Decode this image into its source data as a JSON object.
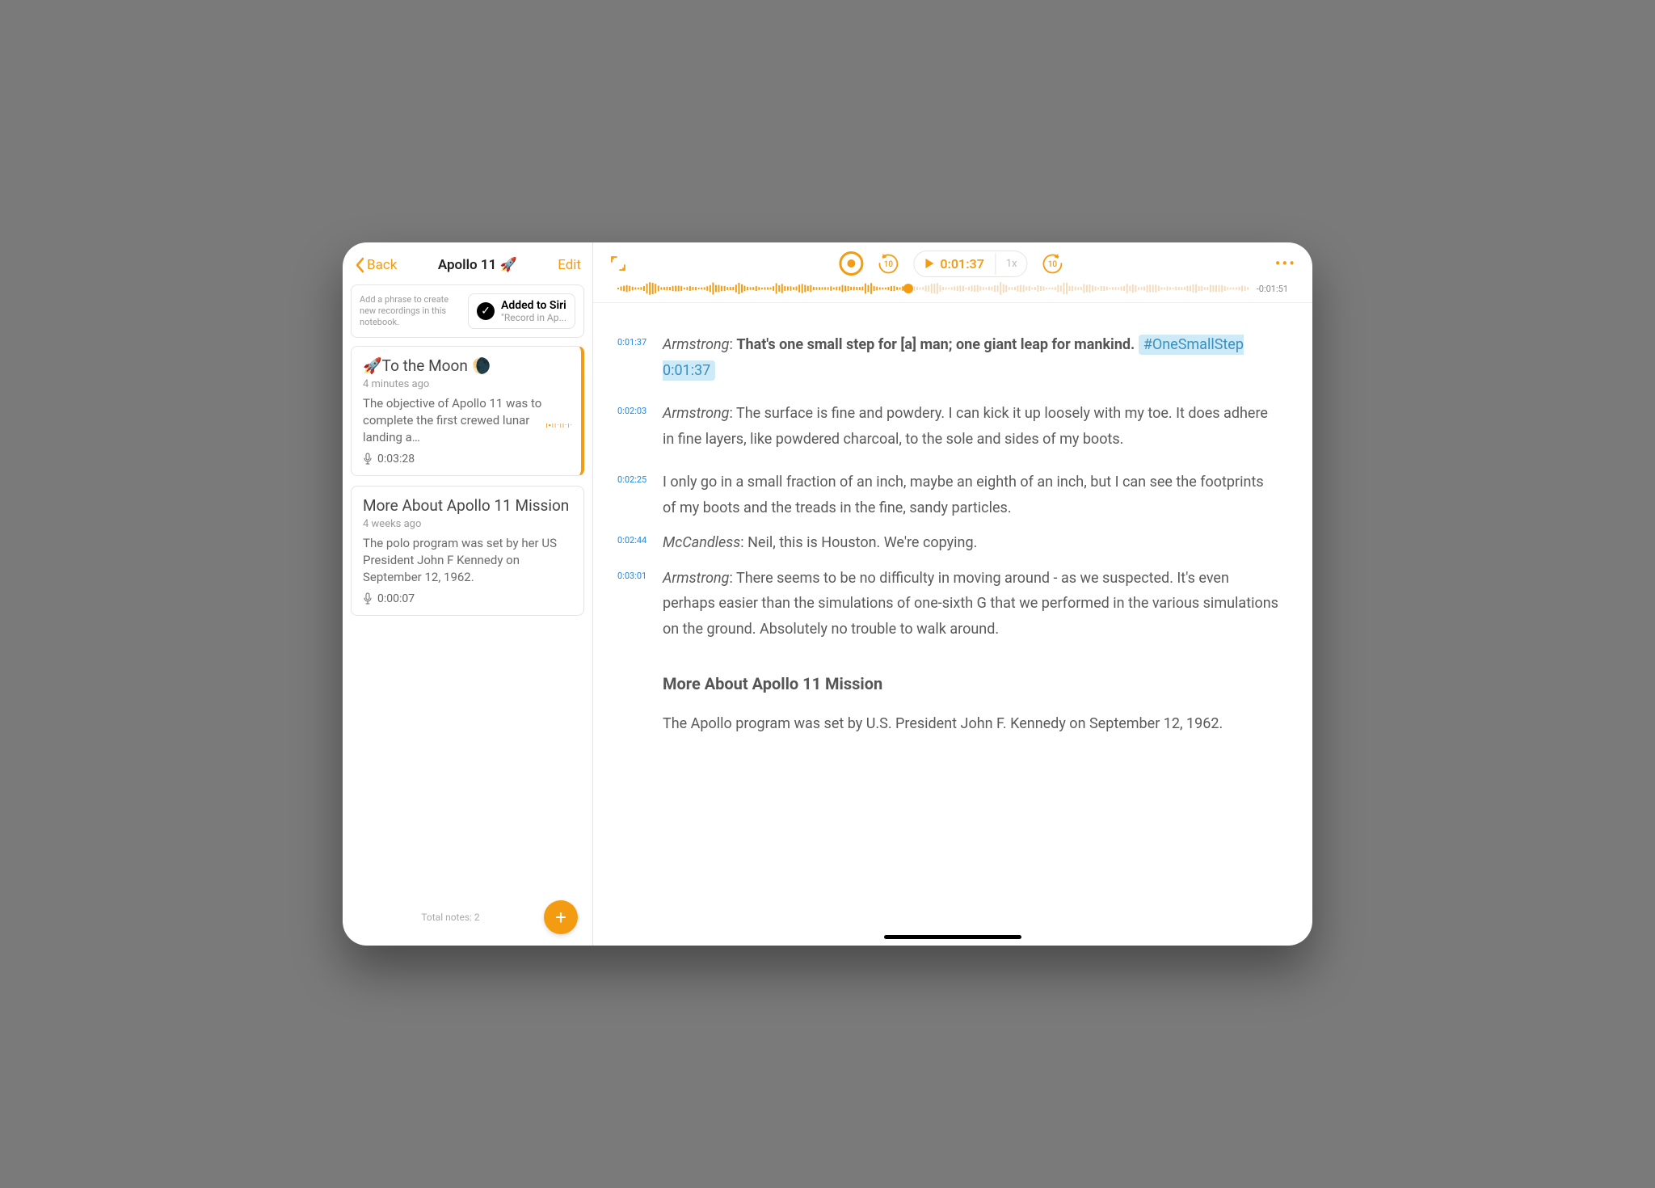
{
  "sidebar": {
    "back_label": "Back",
    "title": "Apollo 11 🚀",
    "edit_label": "Edit",
    "siri_hint": "Add a phrase to create new recordings in this notebook.",
    "siri_title": "Added to Siri",
    "siri_sub": "\"Record in Ap...",
    "total_notes": "Total notes: 2"
  },
  "notes": [
    {
      "title": "🚀To the Moon 🌘",
      "time": "4 minutes ago",
      "preview": "The objective of Apollo 11 was to complete the first crewed lunar landing a…",
      "duration": "0:03:28",
      "active": true,
      "wave": true
    },
    {
      "title": "More About Apollo 11 Mission",
      "time": "4 weeks ago",
      "preview": "The polo program was set by her US President John F Kennedy on September 12, 1962.",
      "duration": "0:00:07",
      "active": false,
      "wave": false
    }
  ],
  "player": {
    "time": "0:01:37",
    "speed": "1x",
    "remaining": "-0:01:51",
    "skip_back": "10",
    "skip_fwd": "10",
    "progress_percent": 46
  },
  "transcript": [
    {
      "ts": "0:01:37",
      "speaker": "Armstrong",
      "bold": true,
      "text": "That's one small step for [a] man; one giant leap for mankind.",
      "tag": "#OneSmallStep 0:01:37"
    },
    {
      "ts": "0:02:03",
      "speaker": "Armstrong",
      "text": "The surface is fine and powdery. I can kick it up loosely with my toe. It does adhere in fine layers, like powdered charcoal, to the sole and sides of my boots."
    },
    {
      "ts": "0:02:25",
      "text": "I only go in a small fraction of an inch, maybe an eighth of an inch, but I can see the footprints of my boots and the treads in the fine, sandy particles."
    },
    {
      "ts": "0:02:44",
      "speaker": "McCandless",
      "text": "Neil, this is Houston. We're copying."
    },
    {
      "ts": "0:03:01",
      "speaker": "Armstrong",
      "text": "There seems to be no difficulty in moving around - as we suspected. It's even perhaps easier than the simulations of one-sixth G that we performed in the various simulations on the ground. Absolutely no trouble to walk around."
    }
  ],
  "section": {
    "heading": "More About Apollo 11 Mission",
    "para": "The Apollo program was set by U.S. President John F. Kennedy on September 12, 1962."
  }
}
